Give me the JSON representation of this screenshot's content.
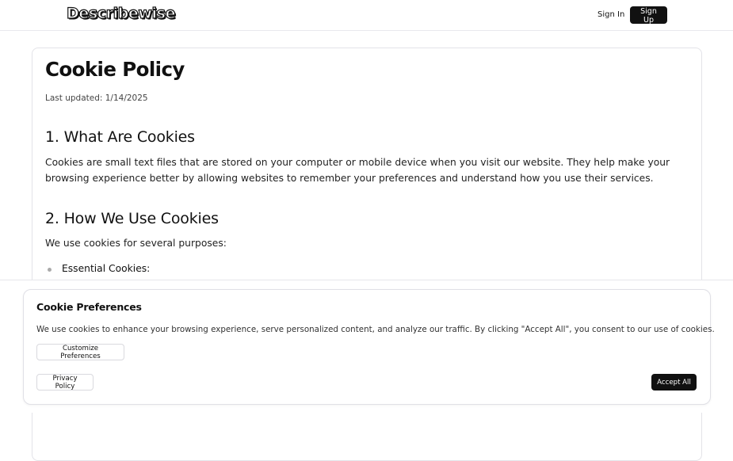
{
  "header": {
    "logo": "Describewise",
    "sign_in": "Sign In",
    "sign_up": "Sign Up"
  },
  "page": {
    "title": "Cookie Policy",
    "last_updated": "Last updated: 1/14/2025",
    "sections": [
      {
        "heading": "1. What Are Cookies",
        "body": "Cookies are small text files that are stored on your computer or mobile device when you visit our website. They help make your browsing experience better by allowing websites to remember your preferences and understand how you use their services."
      },
      {
        "heading": "2. How We Use Cookies",
        "body": "We use cookies for several purposes:",
        "bullets": [
          "Essential Cookies:"
        ]
      }
    ]
  },
  "cookie_banner": {
    "title": "Cookie Preferences",
    "text": "We use cookies to enhance your browsing experience, serve personalized content, and analyze our traffic. By clicking \"Accept All\", you consent to our use of cookies.",
    "customize_label": "Customize Preferences",
    "privacy_label": "Privacy Policy",
    "accept_label": "Accept All"
  },
  "colors": {
    "primary": "#111111",
    "border": "#e3e3e8",
    "bullet": "#aaaaaa"
  }
}
